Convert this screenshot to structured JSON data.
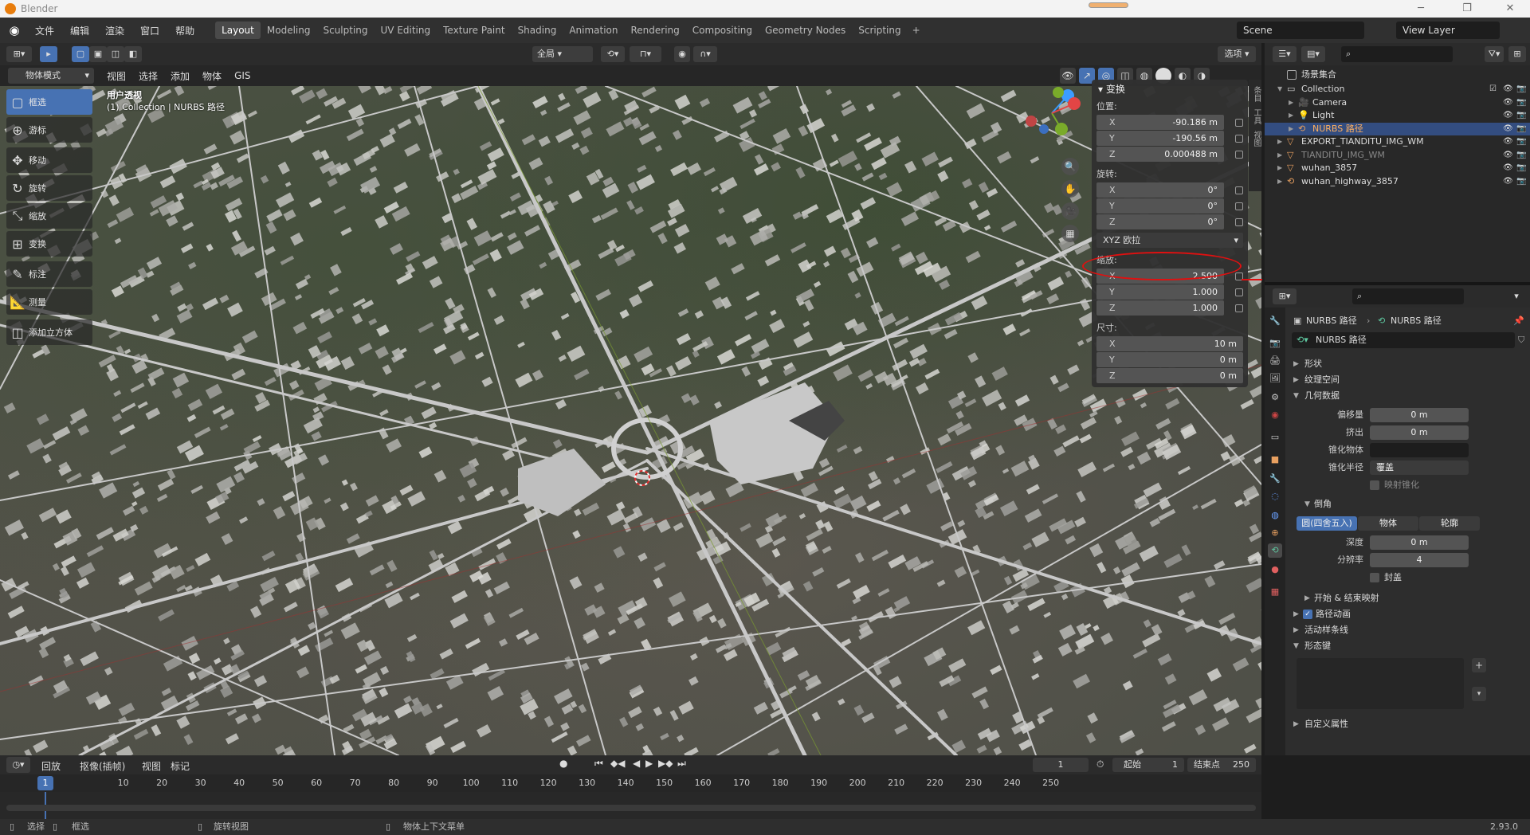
{
  "window": {
    "title": "Blender",
    "minimize": "─",
    "maximize": "❐",
    "close": "✕"
  },
  "menu": {
    "items": [
      "文件",
      "编辑",
      "渲染",
      "窗口",
      "帮助"
    ]
  },
  "workspaces": {
    "tabs": [
      "Layout",
      "Modeling",
      "Sculpting",
      "UV Editing",
      "Texture Paint",
      "Shading",
      "Animation",
      "Rendering",
      "Compositing",
      "Geometry Nodes",
      "Scripting"
    ],
    "active": "Layout",
    "add": "+"
  },
  "scene": {
    "name": "Scene",
    "view_layer": "View Layer"
  },
  "viewport_header": {
    "mode": "物体模式",
    "menus": [
      "视图",
      "选择",
      "添加",
      "物体",
      "GIS"
    ],
    "transform_orientation": "全局",
    "options": "选项"
  },
  "viewport": {
    "view_name": "用户透视",
    "collection_line": "(1) Collection | NURBS 路径"
  },
  "toolbar": {
    "tools": [
      {
        "label": "框选",
        "icon": "▢",
        "active": true
      },
      {
        "label": "游标",
        "icon": "⊕",
        "active": false
      },
      {
        "label": "移动",
        "icon": "✥",
        "active": false
      },
      {
        "label": "旋转",
        "icon": "↻",
        "active": false
      },
      {
        "label": "缩放",
        "icon": "⤡",
        "active": false
      },
      {
        "label": "变换",
        "icon": "⊞",
        "active": false
      },
      {
        "label": "标注",
        "icon": "✎",
        "active": false
      },
      {
        "label": "测量",
        "icon": "📐",
        "active": false
      },
      {
        "label": "添加立方体",
        "icon": "◫",
        "active": false
      }
    ]
  },
  "npanel": {
    "title": "变换",
    "location_label": "位置:",
    "location": [
      {
        "axis": "X",
        "value": "-90.186 m"
      },
      {
        "axis": "Y",
        "value": "-190.56 m"
      },
      {
        "axis": "Z",
        "value": "0.000488 m"
      }
    ],
    "rotation_label": "旋转:",
    "rotation": [
      {
        "axis": "X",
        "value": "0°"
      },
      {
        "axis": "Y",
        "value": "0°"
      },
      {
        "axis": "Z",
        "value": "0°"
      }
    ],
    "rotation_mode": "XYZ 欧拉",
    "scale_label": "缩放:",
    "scale": [
      {
        "axis": "X",
        "value": "2.500"
      },
      {
        "axis": "Y",
        "value": "1.000"
      },
      {
        "axis": "Z",
        "value": "1.000"
      }
    ],
    "dimensions_label": "尺寸:",
    "dimensions": [
      {
        "axis": "X",
        "value": "10 m"
      },
      {
        "axis": "Y",
        "value": "0 m"
      },
      {
        "axis": "Z",
        "value": "0 m"
      }
    ]
  },
  "outliner": {
    "root": "场景集合",
    "rows": [
      {
        "name": "Collection",
        "indent": 1,
        "icon": "collection",
        "color": "#cfcfcf",
        "selected": false,
        "dim": false
      },
      {
        "name": "Camera",
        "indent": 2,
        "icon": "camera",
        "color": "#e8a060",
        "selected": false,
        "dim": false
      },
      {
        "name": "Light",
        "indent": 2,
        "icon": "light",
        "color": "#e8a060",
        "selected": false,
        "dim": false
      },
      {
        "name": "NURBS 路径",
        "indent": 2,
        "icon": "curve",
        "color": "#e8a060",
        "selected": true,
        "dim": false
      },
      {
        "name": "EXPORT_TIANDITU_IMG_WM",
        "indent": 1,
        "icon": "mesh",
        "color": "#e8a060",
        "selected": false,
        "dim": false
      },
      {
        "name": "TIANDITU_IMG_WM",
        "indent": 1,
        "icon": "mesh",
        "color": "#e8a060",
        "selected": false,
        "dim": true
      },
      {
        "name": "wuhan_3857",
        "indent": 1,
        "icon": "mesh",
        "color": "#e8a060",
        "selected": false,
        "dim": false
      },
      {
        "name": "wuhan_highway_3857",
        "indent": 1,
        "icon": "curve",
        "color": "#e8a060",
        "selected": false,
        "dim": false
      }
    ]
  },
  "properties": {
    "breadcrumb_obj": "NURBS 路径",
    "breadcrumb_data": "NURBS 路径",
    "datablock": "NURBS 路径",
    "sections": {
      "shape": "形状",
      "texture_space": "纹理空间",
      "geometry": "几何数据"
    },
    "geometry": {
      "offset_label": "偏移量",
      "offset": "0 m",
      "extrude_label": "挤出",
      "extrude": "0 m",
      "taper_label": "锥化物体",
      "taper_radius_label": "锥化半径",
      "taper_radius": "覆盖",
      "map_taper": "映射锥化"
    },
    "bevel": {
      "title": "倒角",
      "modes": [
        "圆(四舍五入)",
        "物体",
        "轮廓"
      ],
      "depth_label": "深度",
      "depth": "0 m",
      "resolution_label": "分辨率",
      "resolution": "4",
      "fill_caps": "封盖",
      "start_end": "开始 & 结束映射"
    },
    "path_anim": "路径动画",
    "active_spline": "活动样条线",
    "shape_keys": "形态键",
    "custom_props": "自定义属性"
  },
  "timeline": {
    "playback": "回放",
    "keying": "抠像(插帧)",
    "view": "视图",
    "marker": "标记",
    "current_frame": "1",
    "start_label": "起始",
    "start": "1",
    "end_label": "结束点",
    "end": "250",
    "ticks": [
      "1",
      "10",
      "20",
      "30",
      "40",
      "50",
      "60",
      "70",
      "80",
      "90",
      "100",
      "110",
      "120",
      "130",
      "140",
      "150",
      "160",
      "170",
      "180",
      "190",
      "200",
      "210",
      "220",
      "230",
      "240",
      "250"
    ]
  },
  "status": {
    "select": "选择",
    "box_select": "框选",
    "rotate_view": "旋转视图",
    "context_menu": "物体上下文菜单",
    "version": "2.93.0"
  },
  "colors": {
    "accent": "#4772b3",
    "annotation": "#e01010",
    "selection": "#334d80"
  }
}
